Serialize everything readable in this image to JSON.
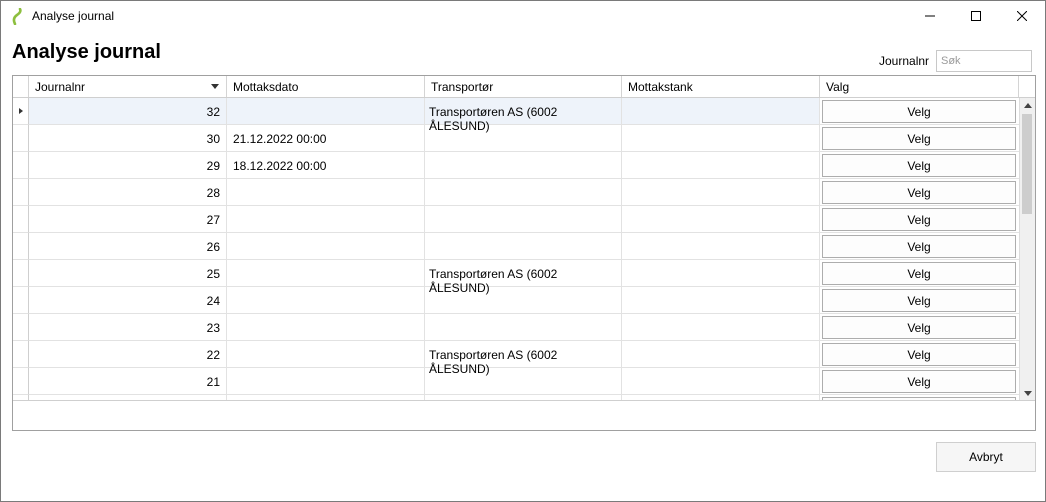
{
  "window": {
    "title": "Analyse journal"
  },
  "heading": "Analyse journal",
  "search": {
    "label": "Journalnr",
    "placeholder": "Søk",
    "value": ""
  },
  "grid": {
    "columns": [
      "Journalnr",
      "Mottaksdato",
      "Transportør",
      "Mottakstank",
      "Valg"
    ],
    "sorted_column": "Journalnr",
    "selected_row": 0,
    "rows": [
      {
        "journalnr": "32",
        "mottaksdato": "",
        "transportor": "Transportøren AS (6002 ÅLESUND)",
        "mottakstank": "",
        "valg": "Velg"
      },
      {
        "journalnr": "30",
        "mottaksdato": "21.12.2022 00:00",
        "transportor": "",
        "mottakstank": "",
        "valg": "Velg"
      },
      {
        "journalnr": "29",
        "mottaksdato": "18.12.2022 00:00",
        "transportor": "",
        "mottakstank": "",
        "valg": "Velg"
      },
      {
        "journalnr": "28",
        "mottaksdato": "",
        "transportor": "",
        "mottakstank": "",
        "valg": "Velg"
      },
      {
        "journalnr": "27",
        "mottaksdato": "",
        "transportor": "",
        "mottakstank": "",
        "valg": "Velg"
      },
      {
        "journalnr": "26",
        "mottaksdato": "",
        "transportor": "",
        "mottakstank": "",
        "valg": "Velg"
      },
      {
        "journalnr": "25",
        "mottaksdato": "",
        "transportor": "Transportøren AS (6002 ÅLESUND)",
        "mottakstank": "",
        "valg": "Velg"
      },
      {
        "journalnr": "24",
        "mottaksdato": "",
        "transportor": "",
        "mottakstank": "",
        "valg": "Velg"
      },
      {
        "journalnr": "23",
        "mottaksdato": "",
        "transportor": "",
        "mottakstank": "",
        "valg": "Velg"
      },
      {
        "journalnr": "22",
        "mottaksdato": "",
        "transportor": "Transportøren AS (6002 ÅLESUND)",
        "mottakstank": "",
        "valg": "Velg"
      },
      {
        "journalnr": "21",
        "mottaksdato": "",
        "transportor": "",
        "mottakstank": "",
        "valg": "Velg"
      },
      {
        "journalnr": "",
        "mottaksdato": "",
        "transportor": "",
        "mottakstank": "",
        "valg": ""
      }
    ]
  },
  "buttons": {
    "cancel": "Avbryt"
  },
  "colors": {
    "selected_row": "#eef3fa",
    "app_icon": "#8dbf3f"
  },
  "icons": {
    "app": "app-logo-icon",
    "minimize": "minimize-icon",
    "maximize": "maximize-icon",
    "close": "close-icon"
  }
}
